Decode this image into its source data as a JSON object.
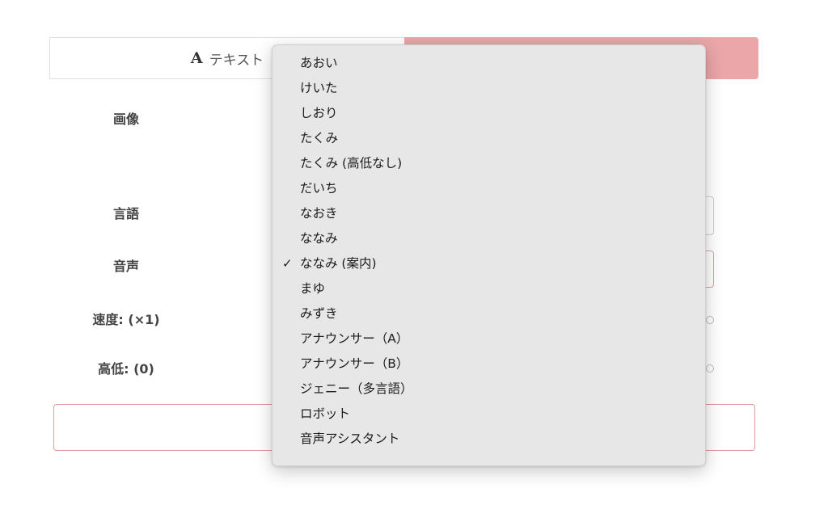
{
  "tabs": {
    "text_icon": "A",
    "text_label": "テキスト"
  },
  "form": {
    "image_label": "画像",
    "language_label": "言語",
    "voice_label": "音声",
    "speed_label": "速度: (×1)",
    "pitch_label": "高低: (0)"
  },
  "voice_menu": {
    "selected": "ななみ (案内)",
    "check_glyph": "✓",
    "items": [
      "あおい",
      "けいた",
      "しおり",
      "たくみ",
      "たくみ (高低なし)",
      "だいち",
      "なおき",
      "ななみ",
      "ななみ (案内)",
      "まゆ",
      "みずき",
      "アナウンサー（A）",
      "アナウンサー（B）",
      "ジェニー（多言語）",
      "ロボット",
      "音声アシスタント"
    ]
  },
  "colors": {
    "accent": "#eaa6a8",
    "accent_border": "#e79a9c",
    "menu_background": "#e7e7e8"
  }
}
